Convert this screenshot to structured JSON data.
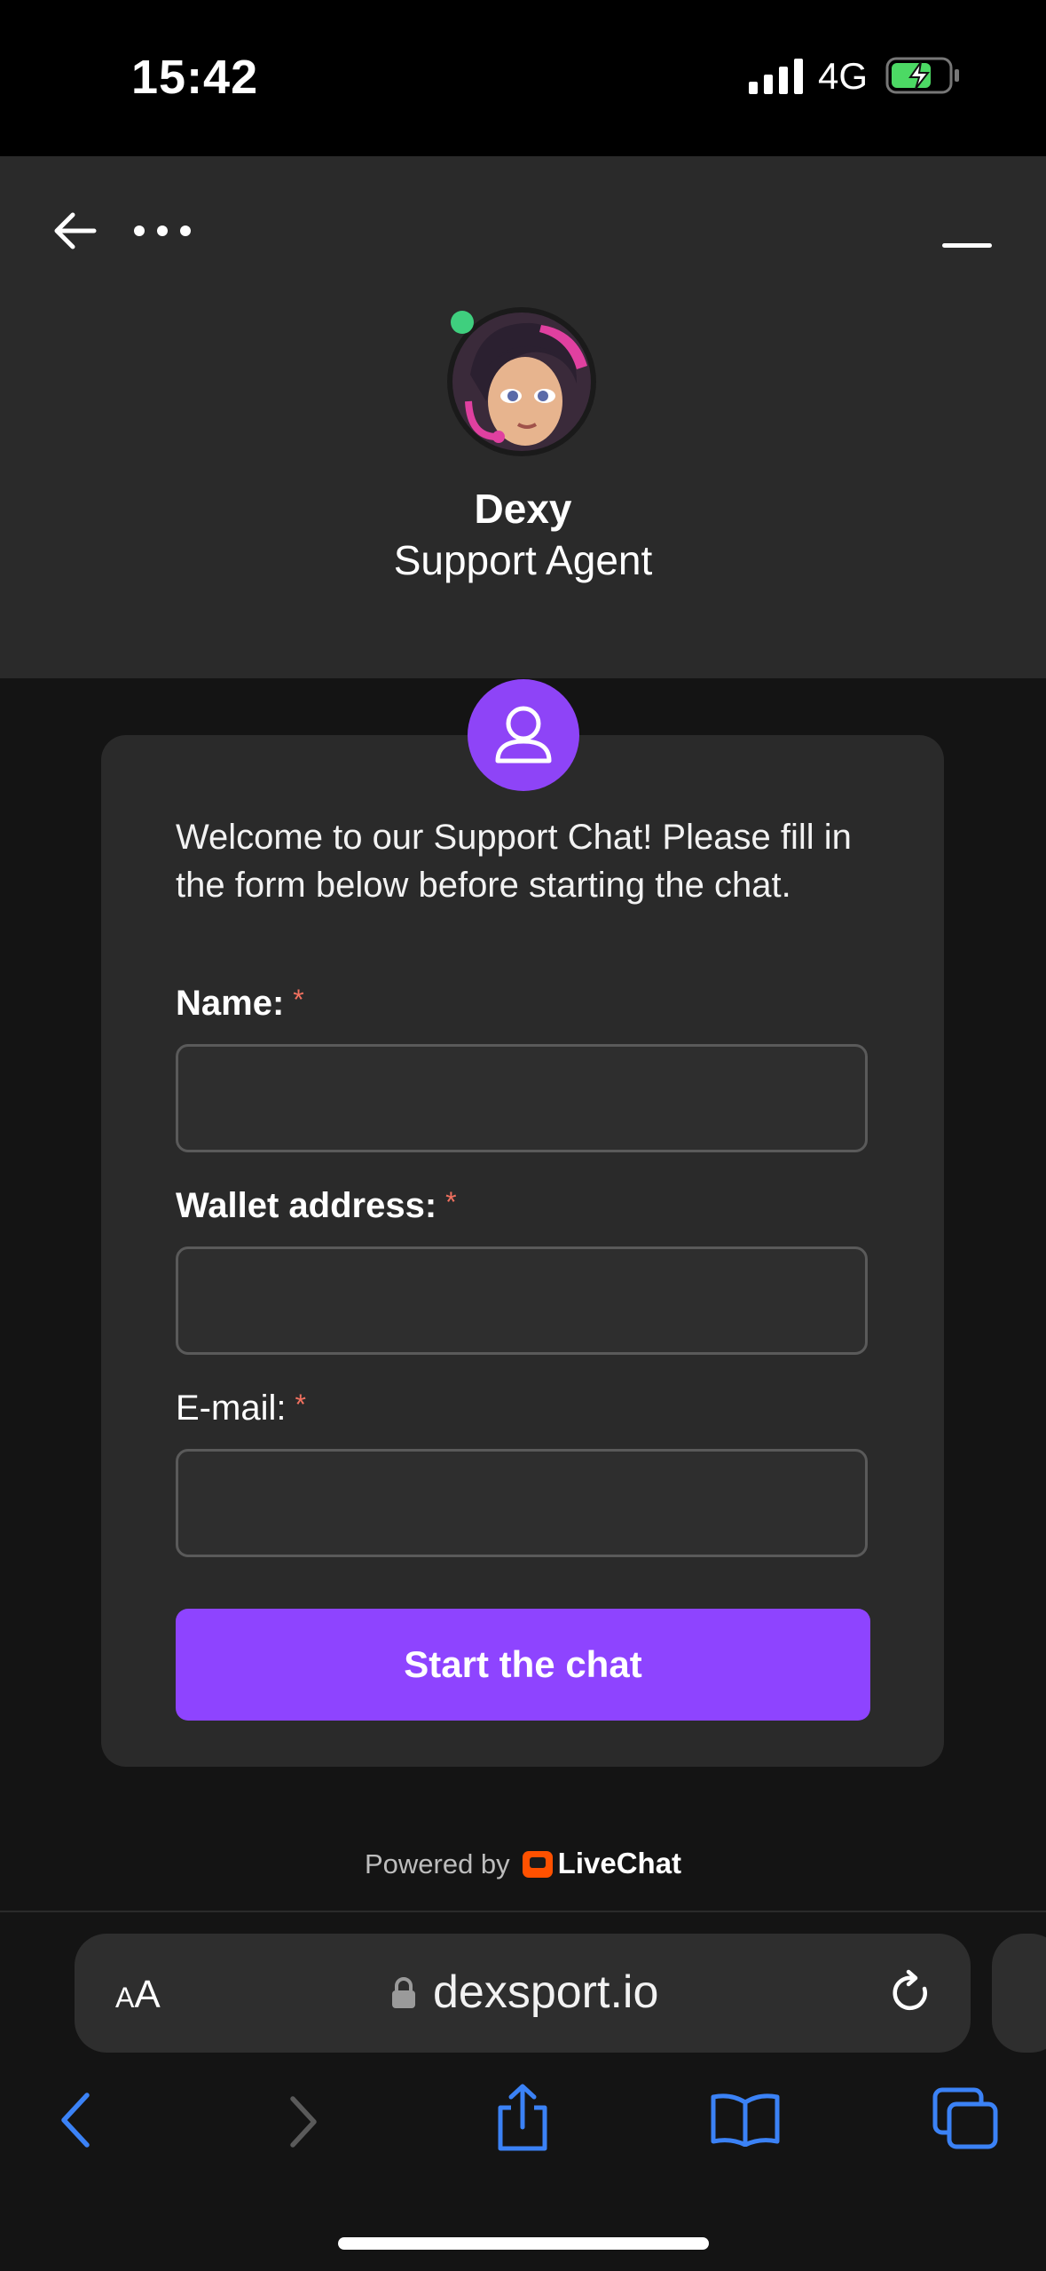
{
  "status_bar": {
    "time": "15:42",
    "network": "4G",
    "battery": "charging"
  },
  "header": {
    "back_icon": "arrow-left-icon",
    "menu_icon": "more-horizontal-icon",
    "minimize_icon": "minimize-icon",
    "agent": {
      "name": "Dexy",
      "role": "Support Agent",
      "online": true
    }
  },
  "form": {
    "intro": "Welcome to our Support Chat! Please fill in the form below before starting the chat.",
    "fields": [
      {
        "label": "Name:",
        "required_mark": "*",
        "value": ""
      },
      {
        "label": "Wallet address:",
        "required_mark": "*",
        "value": ""
      },
      {
        "label": "E-mail:",
        "required_mark": "*",
        "value": ""
      }
    ],
    "submit_label": "Start the chat"
  },
  "footer": {
    "powered_by": "Powered by",
    "brand": "LiveChat"
  },
  "browser": {
    "text_size_label": "AA",
    "url": "dexsport.io"
  },
  "colors": {
    "accent": "#8E44FF",
    "required": "#F0705F",
    "online": "#3FCF7E",
    "ios_blue": "#3B82F6"
  }
}
